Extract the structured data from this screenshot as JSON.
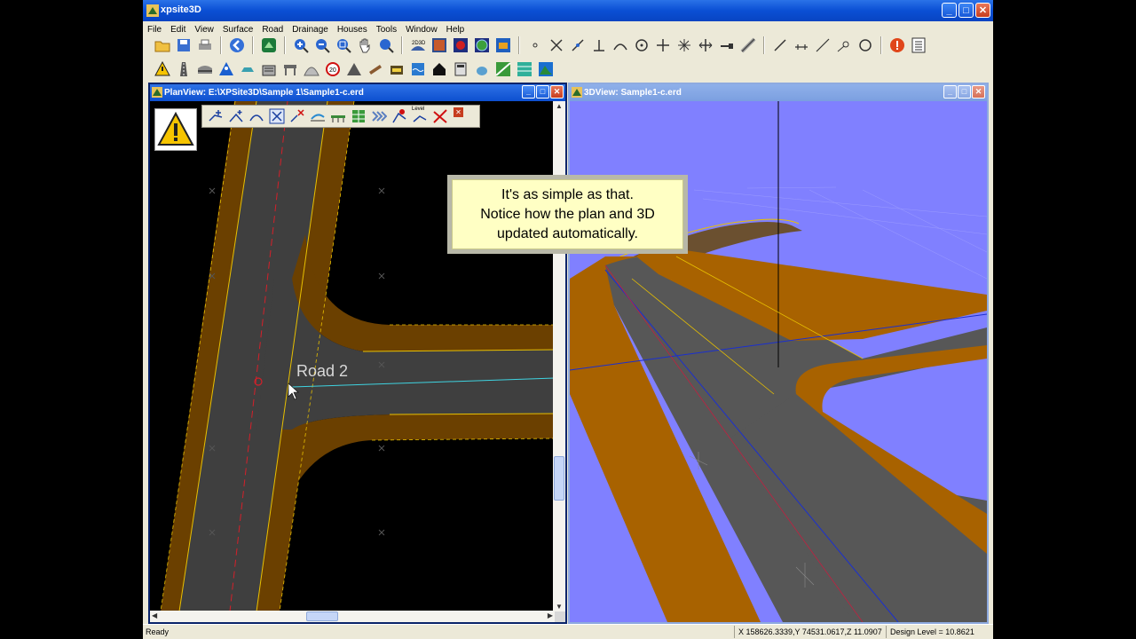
{
  "app": {
    "title": "xpsite3D",
    "title_icon": "xpsite3d-app-icon",
    "window_controls": {
      "minimize": "_",
      "maximize": "□",
      "close": "✕"
    }
  },
  "menu": [
    "File",
    "Edit",
    "View",
    "Surface",
    "Road",
    "Drainage",
    "Houses",
    "Tools",
    "Window",
    "Help"
  ],
  "toolbar1_icons": [
    "open-folder-icon",
    "save-icon",
    "print-icon",
    "back-arrow-icon",
    "surface-icon",
    "zoom-in-icon",
    "zoom-out-icon",
    "zoom-window-icon",
    "pan-hand-icon",
    "zoom-extents-icon",
    "2d3d-toggle-icon",
    "texture-icon",
    "render-icon",
    "globe-icon",
    "camera-icon",
    "point-icon",
    "cross-icon",
    "line-icon",
    "perpendicular-icon",
    "arc-icon",
    "target-icon",
    "move-icon",
    "expand-icon",
    "resize-icon",
    "dimension-icon",
    "measure-icon",
    "line-draw-icon",
    "segment-icon",
    "slope-icon",
    "node-icon",
    "rotate-icon",
    "warning-icon",
    "report-icon"
  ],
  "toolbar2_icons": [
    "warning-sign-icon",
    "road-icon",
    "bridge-icon",
    "pedestrian-icon",
    "car-icon",
    "building-icon",
    "barrier-icon",
    "roundabout-icon",
    "speed-sign-icon",
    "tunnel-icon",
    "pipe-icon",
    "culvert-icon",
    "water-icon",
    "house-icon",
    "calculator-icon",
    "tank-icon",
    "grid-green-icon",
    "terrain-icon",
    "mountain-icon"
  ],
  "planview": {
    "title": "PlanView: E:\\XPSite3D\\Sample 1\\Sample1-c.erd",
    "road_label": "Road 2",
    "floating_toolbar_icons": [
      "add-vertex-icon",
      "insert-vertex-icon",
      "curve-icon",
      "fit-icon",
      "delete-vertex-icon",
      "profile-icon",
      "bridge-section-icon",
      "table-icon",
      "chevrons-icon",
      "fillet-icon",
      "level-icon",
      "delete-road-icon"
    ],
    "level_text": "Level",
    "float_close": "✕"
  },
  "view3d": {
    "title": "3DView: Sample1-c.erd"
  },
  "callout": {
    "line1": "It's as simple as that.",
    "line2": "Notice how the plan and 3D",
    "line3": "updated automatically."
  },
  "status": {
    "ready": "Ready",
    "coords": "X 158626.3339,Y 74531.0617,Z 11.0907",
    "design_level": "Design Level = 10.8621"
  },
  "colors": {
    "road_asphalt": "#3f3f3f",
    "road_shoulder": "#6b4000",
    "shoulder_3d": "#a86200",
    "sky_3d": "#8080ff",
    "centerline": "#d4202a",
    "active_line": "#3fd3e0"
  }
}
